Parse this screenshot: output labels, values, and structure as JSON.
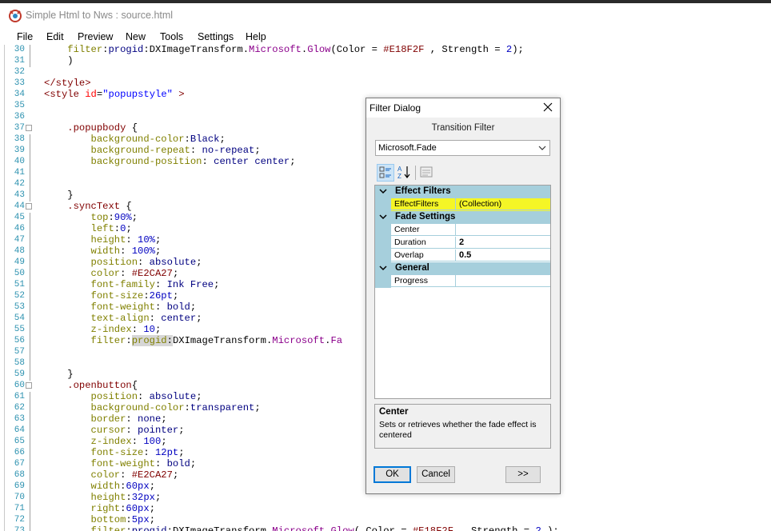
{
  "window": {
    "title": "Simple Html to Nws : source.html"
  },
  "menu": [
    "File",
    "Edit",
    "Preview",
    "New",
    "Tools",
    "Settings",
    "Help"
  ],
  "editor": {
    "line_numbers": [
      "30",
      "31",
      "32",
      "33",
      "34",
      "35",
      "36",
      "37",
      "38",
      "39",
      "40",
      "41",
      "42",
      "43",
      "44",
      "45",
      "46",
      "47",
      "48",
      "49",
      "50",
      "51",
      "52",
      "53",
      "54",
      "55",
      "56",
      "57",
      "58",
      "59",
      "60",
      "61",
      "62",
      "63",
      "64",
      "65",
      "66",
      "67",
      "68",
      "69",
      "70",
      "71",
      "72",
      "73"
    ]
  },
  "dialog": {
    "title": "Filter Dialog",
    "section_label": "Transition Filter",
    "combo_value": "Microsoft.Fade",
    "categories": [
      {
        "name": "Effect Filters",
        "props": [
          {
            "name": "EffectFilters",
            "value": "(Collection)",
            "highlighted": true
          }
        ]
      },
      {
        "name": "Fade Settings",
        "props": [
          {
            "name": "Center",
            "value": ""
          },
          {
            "name": "Duration",
            "value": "2"
          },
          {
            "name": "Overlap",
            "value": "0.5"
          }
        ]
      },
      {
        "name": "General",
        "props": [
          {
            "name": "Progress",
            "value": ""
          }
        ]
      }
    ],
    "description": {
      "title": "Center",
      "text": "Sets or retrieves whether the fade effect is centered"
    },
    "buttons": {
      "ok": "OK",
      "cancel": "Cancel",
      "more": ">>"
    },
    "highlight_color": "#f3f400"
  }
}
